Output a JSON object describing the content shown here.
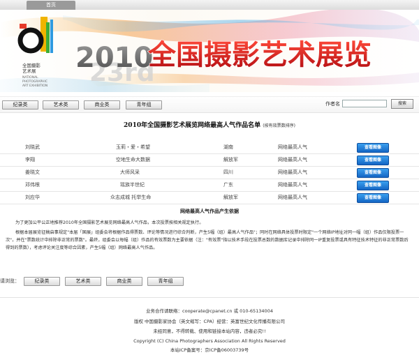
{
  "nav": {
    "home": "首页"
  },
  "banner": {
    "year": "2010",
    "title": "全国摄影艺术展览",
    "ghost_number": "23rd",
    "logo_cn": "全国摄影\n艺术展",
    "logo_en": "NATIONAL\nPHOTOGRAPHIC\nART EXHIBITION"
  },
  "categories": [
    "纪录类",
    "艺术类",
    "商业类",
    "青年组"
  ],
  "search": {
    "label": "作者名",
    "value": "",
    "button": "搜索"
  },
  "page": {
    "title": "2010年全国摄影艺术展览网络最高人气作品名单",
    "subtitle": "(按有效票数排序)"
  },
  "winners": [
    {
      "author": "刘晓武",
      "work": "玉莉・爱・希望",
      "region": "湖南",
      "award": "网络最高人气",
      "button": "查看图像"
    },
    {
      "author": "李翔",
      "work": "空地生命大数据",
      "region": "解放军",
      "award": "网络最高人气",
      "button": "查看图像"
    },
    {
      "author": "姜晓文",
      "work": "大师风采",
      "region": "四川",
      "award": "网络最高人气",
      "button": "查看图像"
    },
    {
      "author": "邓伟根",
      "work": "瑶族半世纪",
      "region": "广东",
      "award": "网络最高人气",
      "button": "查看图像"
    },
    {
      "author": "刘应华",
      "work": "众志成城 托举生命",
      "region": "解放军",
      "award": "网络最高人气",
      "button": "查看图像"
    }
  ],
  "basis": {
    "title": "网络最高人气作品产生依据",
    "p1": "为了更加公平公正地推荐2010年全国摄影艺术展览网络最高人气作品，本次投票按相关规定执行。",
    "p2": "根据本届展览征稿启事规定\"本届「国展」组委会将根据作品得票数、评论等情况进行综合判断，产生5幅（组）最高人气作品\"；同时在网络具体投票时限定\"一个网络IP地址对同一幅（组）作品仅限投票一次\"，并在\"票数统计中排除非正常的票数\"。最终，组委会以每幅（组）作品的有效票数为主要依据（注：\"有效票\"指以技术手段在投票总数的数据库记录中排除同一IP重复投票或具有特征技术特征的非正常票数后得到的票数），考虑评论关注度等综合因素，产生5幅（组）网络最高人气作品。"
  },
  "vote": {
    "label": "请浏览：",
    "categories": [
      "纪录类",
      "艺术类",
      "商业类",
      "青年组"
    ]
  },
  "footer": {
    "contact": "业务合作请联络：cooperate@cpanet.cn 或  010-65134004",
    "copyright_cn": "版权  中国摄影家协会（英文缩写：CPA）经营：英富世纪文化传播有限公司",
    "notice": "未经同意，不得转载、使用和链接本站内容，违者必究!!",
    "copyright_en": "Copyright (C) China Photographers Association All Rights Reserved",
    "icp": "本站ICP备案号：京ICP备06003739号"
  },
  "colors": {
    "accent_blue": "#1466c4",
    "title_red": "#d8141a",
    "logo_yellow": "#f0b400",
    "logo_green": "#3cae3a"
  }
}
